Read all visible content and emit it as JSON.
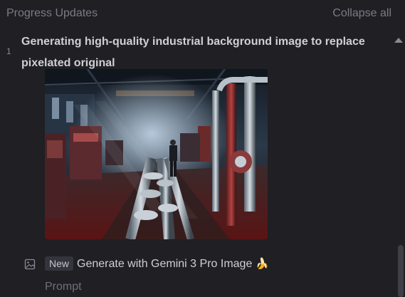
{
  "header": {
    "title": "Progress Updates",
    "collapse_label": "Collapse all"
  },
  "step": {
    "number": "1",
    "title": "Generating high-quality industrial background image to replace pixelated original",
    "expand_icon": "chevron-up-icon"
  },
  "image": {
    "alt": "Generated industrial factory hall with large metal pipes and a worker"
  },
  "tool": {
    "icon": "image-icon",
    "badge": "New",
    "label": "Generate with Gemini 3 Pro Image",
    "emoji": "🍌"
  },
  "prompt": {
    "label": "Prompt"
  },
  "colors": {
    "background": "#1f1f24",
    "muted_text": "#7b7b86",
    "title_text": "#cfcfd6",
    "badge_bg": "#34343c"
  }
}
